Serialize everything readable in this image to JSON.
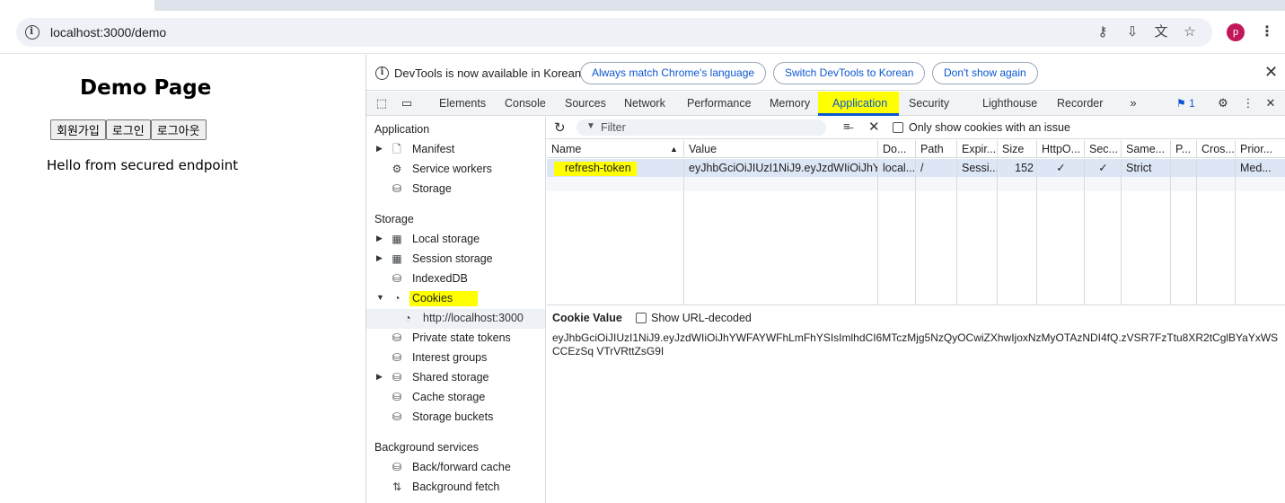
{
  "browser": {
    "url": "localhost:3000/demo",
    "profile_initial": "p"
  },
  "page": {
    "title": "Demo Page",
    "buttons": [
      "회원가입",
      "로그인",
      "로그아웃"
    ],
    "message": "Hello from secured endpoint"
  },
  "infobar": {
    "message": "DevTools is now available in Korean!",
    "match_btn": "Always match Chrome's language",
    "switch_btn": "Switch DevTools to Korean",
    "dont_show_btn": "Don't show again"
  },
  "tabs": [
    "Elements",
    "Console",
    "Sources",
    "Network",
    "Performance",
    "Memory",
    "Application",
    "Security",
    "Lighthouse",
    "Recorder"
  ],
  "active_tab": "Application",
  "issues_count": "1",
  "sidebar": {
    "application_header": "Application",
    "application_items": [
      "Manifest",
      "Service workers",
      "Storage"
    ],
    "storage_header": "Storage",
    "storage_items": [
      "Local storage",
      "Session storage",
      "IndexedDB",
      "Cookies",
      "http://localhost:3000",
      "Private state tokens",
      "Interest groups",
      "Shared storage",
      "Cache storage",
      "Storage buckets"
    ],
    "background_header": "Background services",
    "background_items": [
      "Back/forward cache",
      "Background fetch"
    ]
  },
  "filter": {
    "placeholder": "Filter",
    "only_issues_label": "Only show cookies with an issue"
  },
  "cookie_table": {
    "headers": [
      "Name",
      "Value",
      "Do...",
      "Path",
      "Expir...",
      "Size",
      "HttpO...",
      "Sec...",
      "Same...",
      "P...",
      "Cros...",
      "Prior..."
    ],
    "rows": [
      [
        "refresh-token",
        "eyJhbGciOiJIUzI1NiJ9.eyJzdWIiOiJhY...",
        "local...",
        "/",
        "Sessi...",
        "152",
        "✓",
        "✓",
        "Strict",
        "",
        "",
        "Med..."
      ]
    ]
  },
  "cookie_detail": {
    "title": "Cookie Value",
    "url_decoded_label": "Show URL-decoded",
    "value": "eyJhbGciOiJIUzI1NiJ9.eyJzdWIiOiJhYWFAYWFhLmFhYSIsImlhdCI6MTczMjg5NzQyOCwiZXhwIjoxNzMyOTAzNDI4fQ.zVSR7FzTtu8XR2tCglBYaYxWSCCEzSq VTrVRttZsG9I"
  },
  "colors": {
    "highlight": "#ffff00",
    "accent": "#0b57d0",
    "selected_row": "#dde6f5"
  }
}
